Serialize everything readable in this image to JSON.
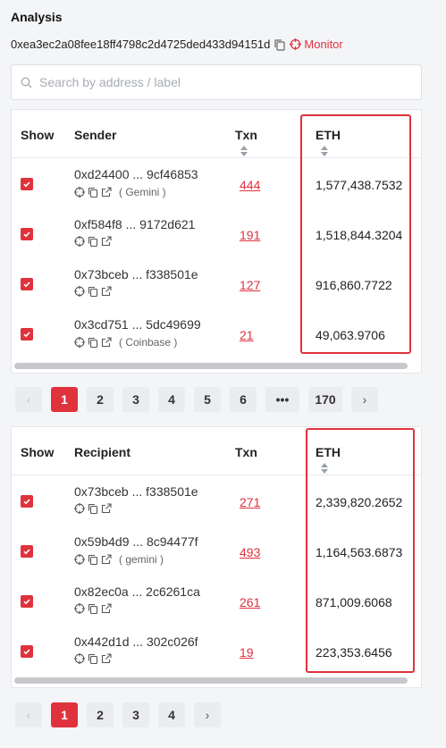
{
  "header": {
    "title": "Analysis",
    "address": "0xea3ec2a08fee18ff4798c2d4725ded433d94151d",
    "monitor_label": "Monitor"
  },
  "search": {
    "placeholder": "Search by address / label"
  },
  "senders": {
    "columns": {
      "show": "Show",
      "party": "Sender",
      "txn": "Txn",
      "eth": "ETH"
    },
    "rows": [
      {
        "address": "0xd24400 ... 9cf46853",
        "label": "( Gemini )",
        "txn": "444",
        "eth": "1,577,438.7532"
      },
      {
        "address": "0xf584f8 ... 9172d621",
        "label": "",
        "txn": "191",
        "eth": "1,518,844.3204"
      },
      {
        "address": "0x73bceb ... f338501e",
        "label": "",
        "txn": "127",
        "eth": "916,860.7722"
      },
      {
        "address": "0x3cd751 ... 5dc49699",
        "label": "( Coinbase )",
        "txn": "21",
        "eth": "49,063.9706"
      }
    ],
    "pagination": {
      "prev": "‹",
      "pages": [
        "1",
        "2",
        "3",
        "4",
        "5",
        "6",
        "•••",
        "170"
      ],
      "next": "›",
      "current": "1"
    }
  },
  "recipients": {
    "columns": {
      "show": "Show",
      "party": "Recipient",
      "txn": "Txn",
      "eth": "ETH"
    },
    "rows": [
      {
        "address": "0x73bceb ... f338501e",
        "label": "",
        "txn": "271",
        "eth": "2,339,820.2652"
      },
      {
        "address": "0x59b4d9 ... 8c94477f",
        "label": "( gemini )",
        "txn": "493",
        "eth": "1,164,563.6873"
      },
      {
        "address": "0x82ec0a ... 2c6261ca",
        "label": "",
        "txn": "261",
        "eth": "871,009.6068"
      },
      {
        "address": "0x442d1d ... 302c026f",
        "label": "",
        "txn": "19",
        "eth": "223,353.6456"
      }
    ],
    "pagination": {
      "prev": "‹",
      "pages": [
        "1",
        "2",
        "3",
        "4"
      ],
      "next": "›",
      "current": "1"
    }
  },
  "colors": {
    "accent": "#e0323d",
    "background": "#f4f5f7"
  },
  "icons": [
    "copy-icon",
    "crosshair-icon",
    "search-icon",
    "external-link-icon",
    "checkbox-checked-icon",
    "sort-icon"
  ]
}
